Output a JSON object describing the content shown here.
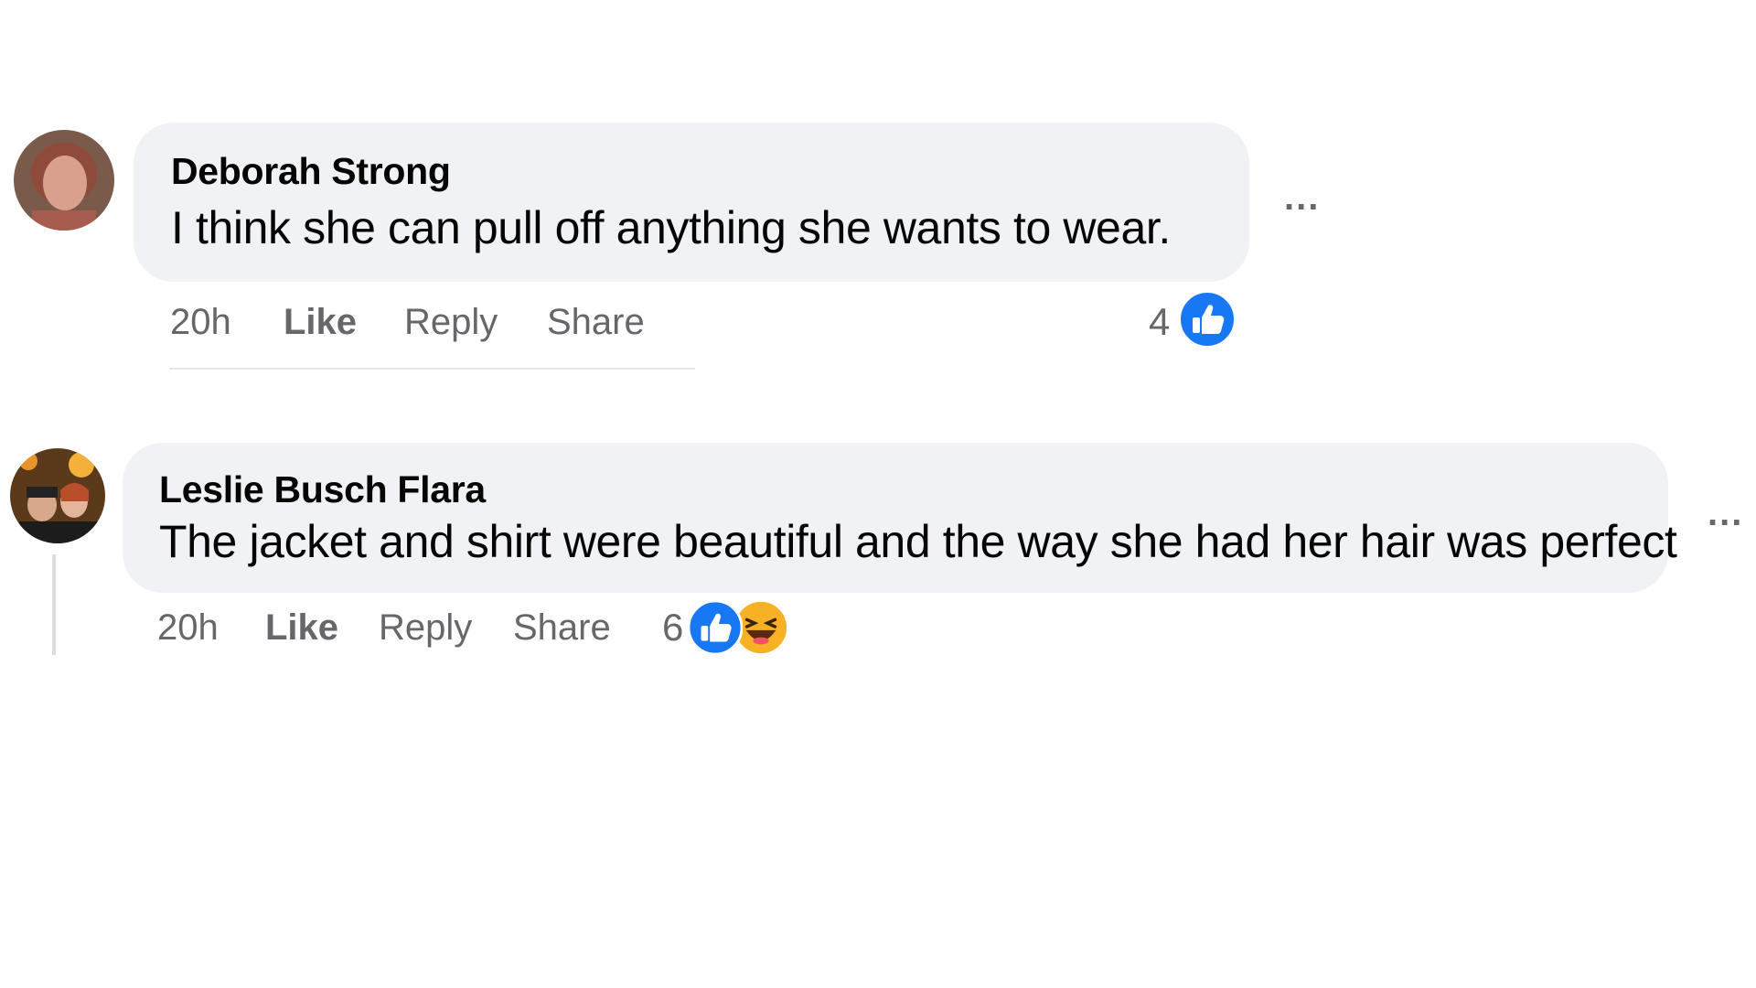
{
  "comments": [
    {
      "author": "Deborah Strong",
      "text": "I think she can pull off anything she wants to wear.",
      "time": "20h",
      "like_label": "Like",
      "reply_label": "Reply",
      "share_label": "Share",
      "reaction_count": "4",
      "reactions": [
        "like-icon"
      ],
      "more_label": "..."
    },
    {
      "author": "Leslie Busch Flara",
      "text": "The jacket and shirt were beautiful and the way she had her hair was perfect",
      "time": "20h",
      "like_label": "Like",
      "reply_label": "Reply",
      "share_label": "Share",
      "reaction_count": "6",
      "reactions": [
        "like-icon",
        "haha-icon"
      ],
      "more_label": "..."
    }
  ],
  "colors": {
    "bubble": "#f0f2f5",
    "meta_text": "#65676b",
    "like_blue": "#1877f2",
    "haha_yellow": "#f7b125"
  }
}
